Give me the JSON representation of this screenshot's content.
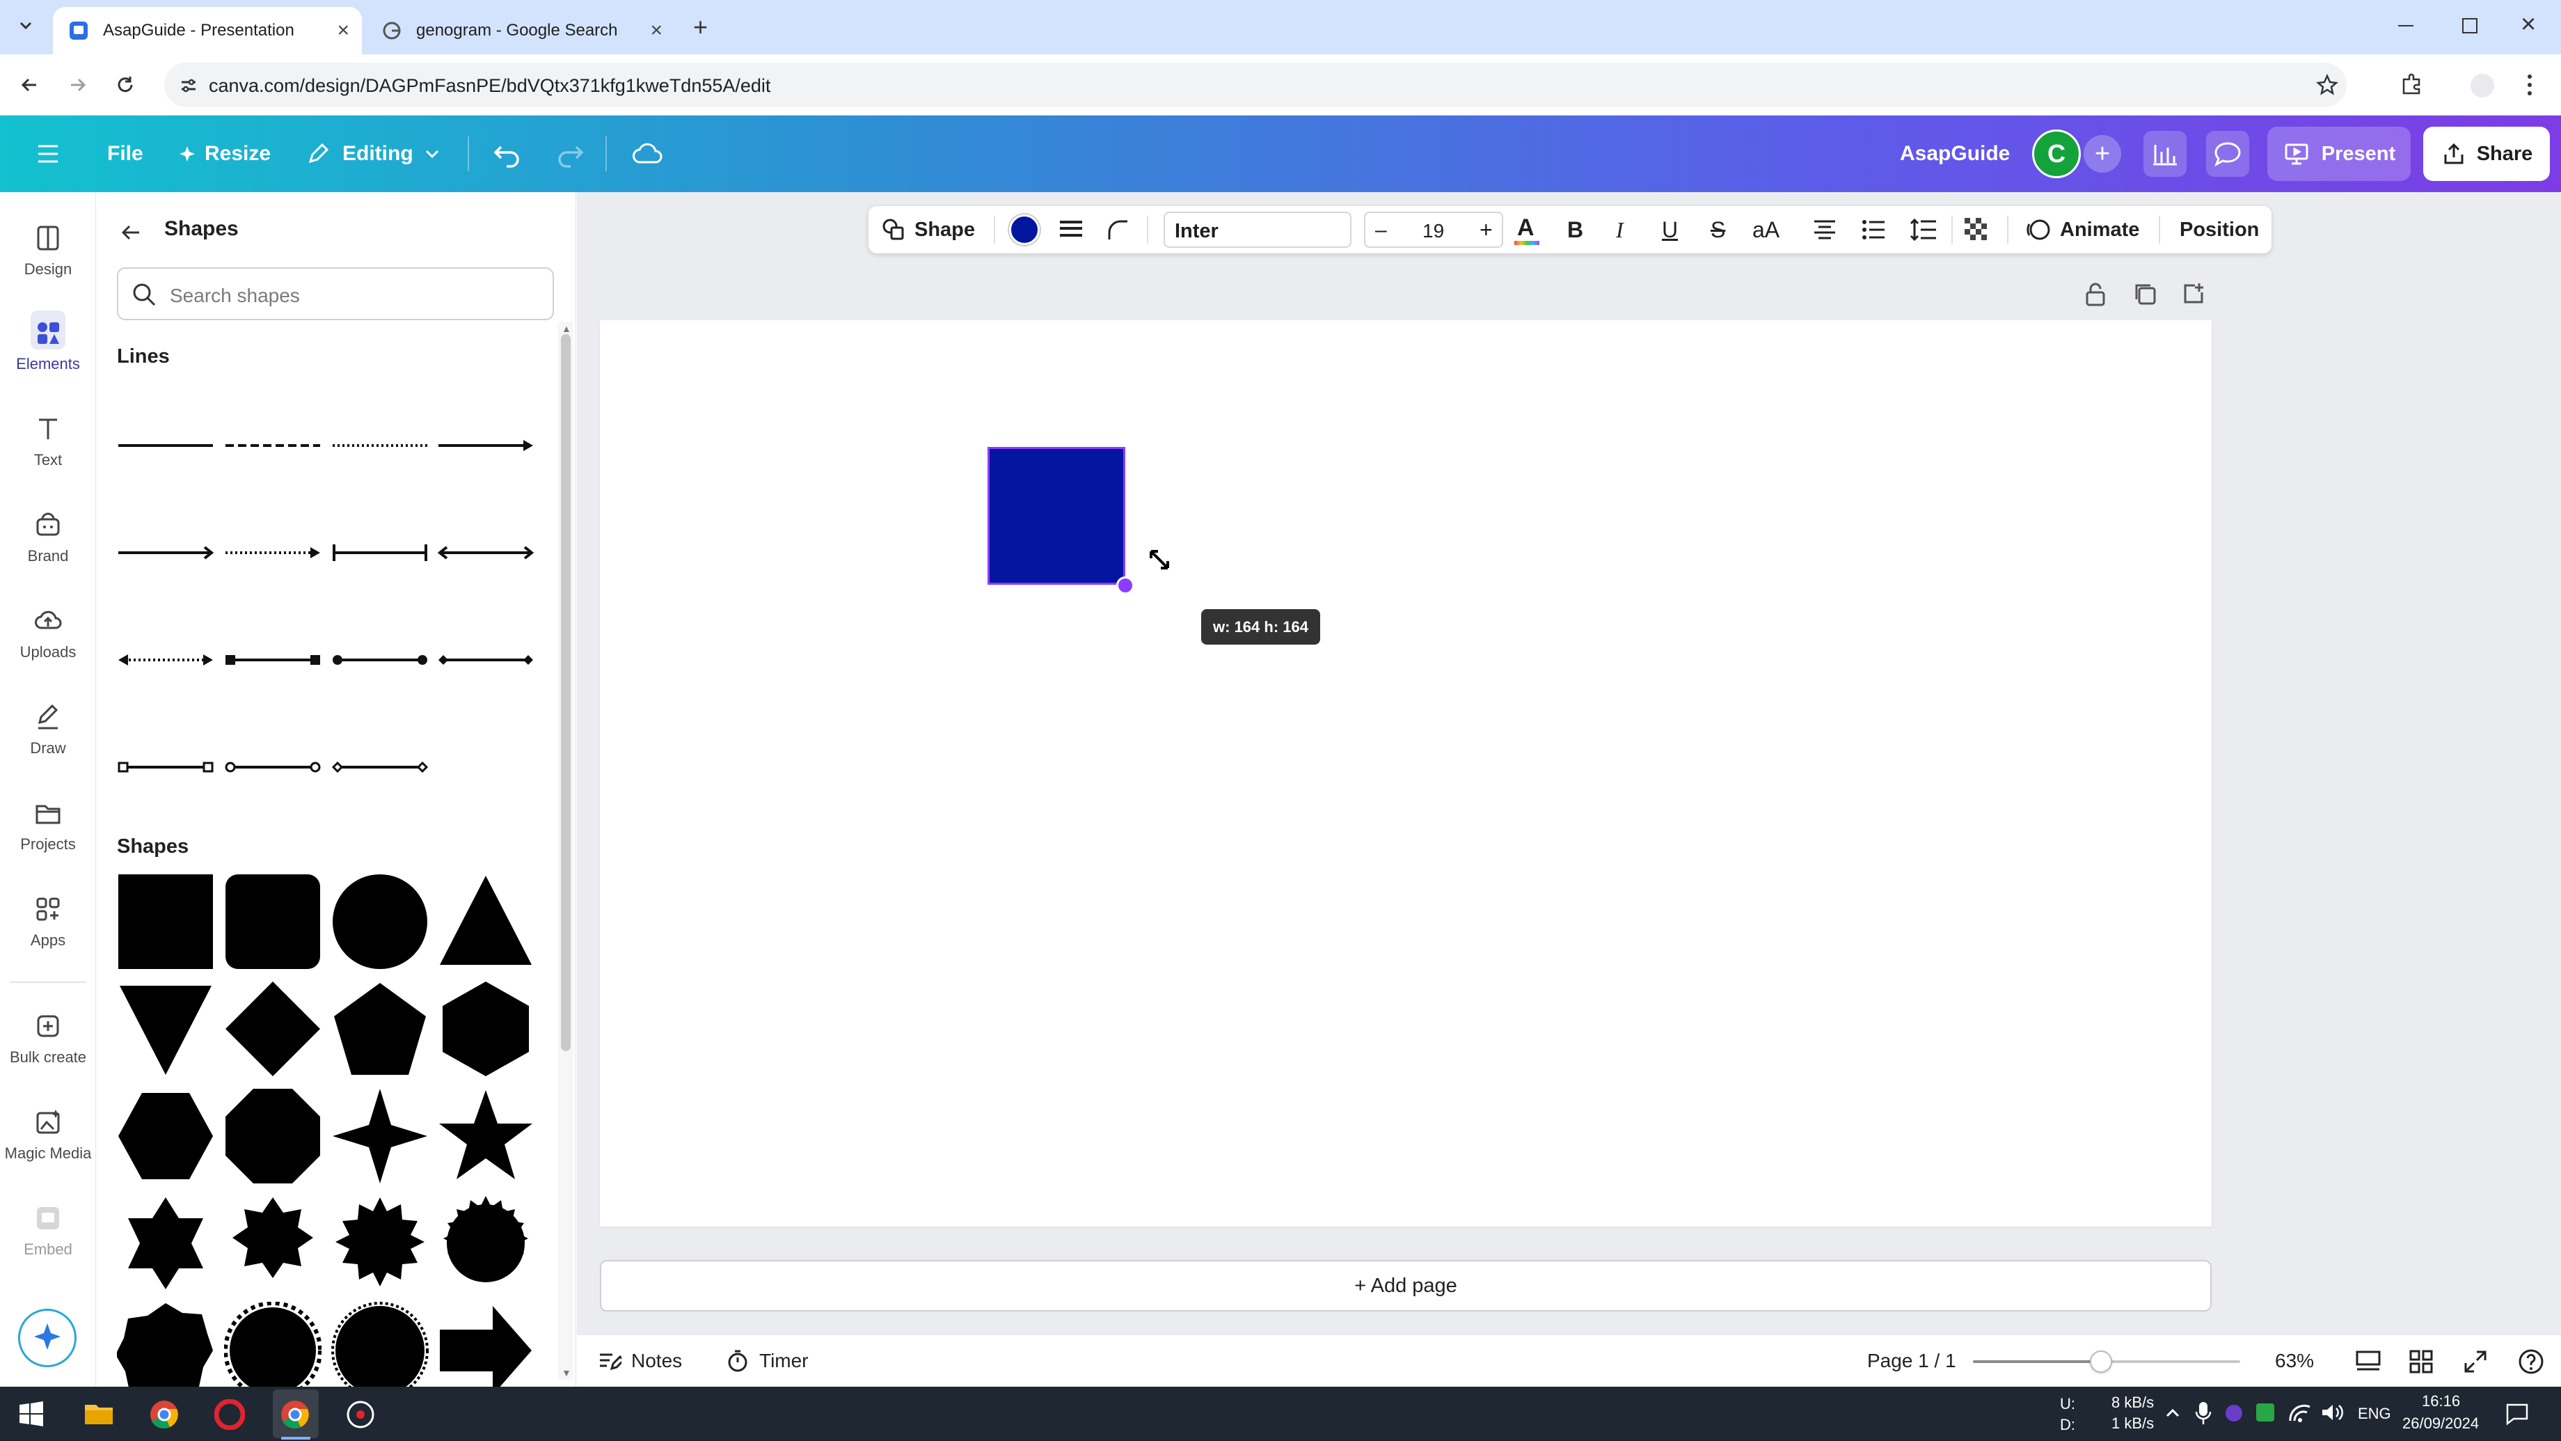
{
  "browser": {
    "tabs": [
      {
        "title": "AsapGuide - Presentation",
        "active": true
      },
      {
        "title": "genogram - Google Search",
        "active": false
      }
    ],
    "url": "canva.com/design/DAGPmFasnPE/bdVQtx371kfg1kweTdn55A/edit"
  },
  "header": {
    "file": "File",
    "resize": "Resize",
    "editing": "Editing",
    "team": "AsapGuide",
    "avatar": "C",
    "present": "Present",
    "share": "Share",
    "colors": {
      "gradient_start": "#13c1cf",
      "gradient_end": "#7d3ce6",
      "avatar": "#14a33a"
    }
  },
  "rail": {
    "items": [
      {
        "label": "Design",
        "icon": "design-icon"
      },
      {
        "label": "Elements",
        "icon": "elements-icon",
        "active": true
      },
      {
        "label": "Text",
        "icon": "text-icon"
      },
      {
        "label": "Brand",
        "icon": "brand-icon"
      },
      {
        "label": "Uploads",
        "icon": "uploads-icon"
      },
      {
        "label": "Draw",
        "icon": "draw-icon"
      },
      {
        "label": "Projects",
        "icon": "projects-icon"
      },
      {
        "label": "Apps",
        "icon": "apps-icon"
      },
      {
        "label": "Bulk create",
        "icon": "bulk-create-icon"
      },
      {
        "label": "Magic Media",
        "icon": "magic-media-icon"
      },
      {
        "label": "Embed",
        "icon": "embed-icon"
      }
    ]
  },
  "panel": {
    "title": "Shapes",
    "search_placeholder": "Search shapes",
    "lines_heading": "Lines",
    "shapes_heading": "Shapes"
  },
  "toolbar": {
    "shape": "Shape",
    "fill_color": "#0416a0",
    "font": "Inter",
    "font_size": "19",
    "minus": "–",
    "plus": "+",
    "bold": "B",
    "italic": "I",
    "underline": "U",
    "strike": "S",
    "case": "aA",
    "animate": "Animate",
    "position": "Position"
  },
  "canvas": {
    "shape_color": "#0416a0",
    "selection_color": "#8b3dff",
    "size_tooltip": "w: 164 h: 164",
    "add_page": "+ Add page"
  },
  "footer": {
    "notes": "Notes",
    "timer": "Timer",
    "page": "Page 1 / 1",
    "zoom": "63%",
    "zoom_level": 0.48
  },
  "taskbar": {
    "net_up_label": "U:",
    "net_down_label": "D:",
    "net_up": "8 kB/s",
    "net_down": "1 kB/s",
    "lang": "ENG",
    "time": "16:16",
    "date": "26/09/2024"
  }
}
